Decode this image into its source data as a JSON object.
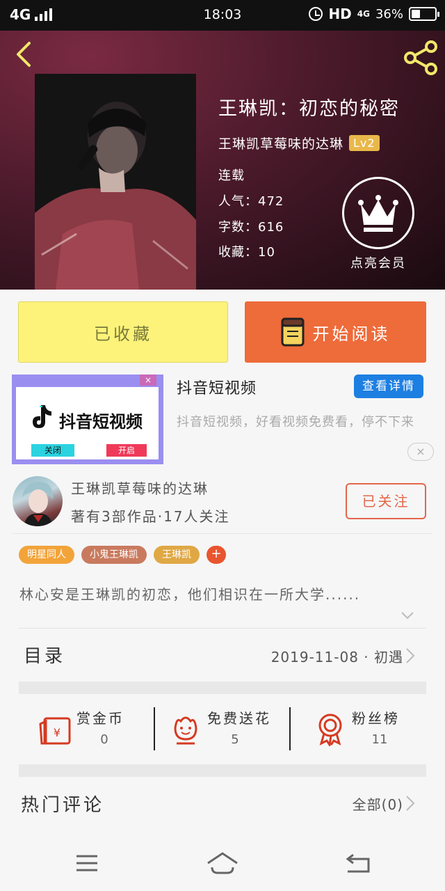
{
  "status_bar": {
    "network": "4G",
    "time": "18:03",
    "hd": "HD",
    "network2": "4G",
    "battery": "36%",
    "battery_level": 0.36
  },
  "book": {
    "title": "王琳凯：初恋的秘密",
    "author": "王琳凯草莓味的达琳",
    "level": "Lv2",
    "status": "连载",
    "popularity": "人气：472",
    "word_count": "字数：616",
    "favorites": "收藏：10",
    "vip_label": "点亮会员"
  },
  "actions": {
    "collected_label": "已收藏",
    "read_label": "开始阅读"
  },
  "ad": {
    "badge_close": "×",
    "image_brand": "抖音短视频",
    "image_btn_close": "关闭",
    "image_btn_open": "开启",
    "title": "抖音短视频",
    "detail_button": "查看详情",
    "description": "抖音短视频，好看视频免费看，停不下来",
    "dismiss": "×"
  },
  "author_card": {
    "name": "王琳凯草莓味的达琳",
    "stats": "著有3部作品·17人关注",
    "follow_label": "已关注"
  },
  "tags": [
    {
      "label": "明星同人",
      "color": "#f2a43a"
    },
    {
      "label": "小鬼王琳凯",
      "color": "#c97a5e"
    },
    {
      "label": "王琳凯",
      "color": "#e0a845"
    }
  ],
  "tag_add": "+",
  "synopsis": "林心安是王琳凯的初恋，他们相识在一所大学......",
  "toc": {
    "label": "目录",
    "latest": "2019-11-08 · 初遇"
  },
  "stats": [
    {
      "title": "赏金币",
      "value": "0",
      "icon": "red-envelope-icon"
    },
    {
      "title": "免费送花",
      "value": "5",
      "icon": "flower-icon"
    },
    {
      "title": "粉丝榜",
      "value": "11",
      "icon": "award-ribbon-icon"
    }
  ],
  "comments": {
    "label": "热门评论",
    "all": "全部(0)"
  },
  "colors": {
    "accent_orange": "#ee6b3a",
    "collected_yellow": "#fdf37a",
    "follow_red": "#e2674a",
    "detail_blue": "#1d7fe2",
    "icon_red": "#d63a22"
  }
}
